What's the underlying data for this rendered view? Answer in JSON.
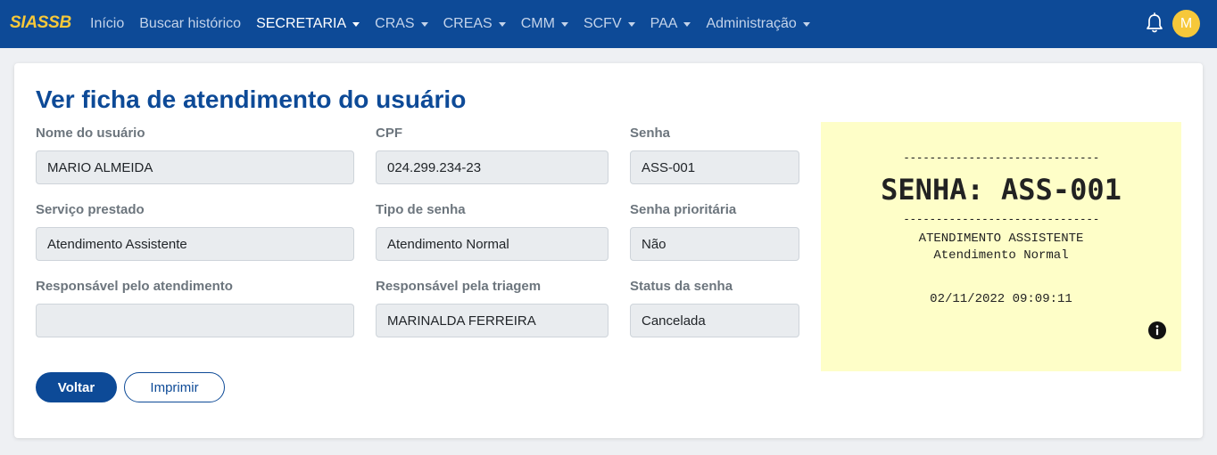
{
  "app": {
    "brand": "SIASSB"
  },
  "nav": {
    "items": [
      {
        "label": "Início",
        "dropdown": false,
        "active": false
      },
      {
        "label": "Buscar histórico",
        "dropdown": false,
        "active": false
      },
      {
        "label": "SECRETARIA",
        "dropdown": true,
        "active": true
      },
      {
        "label": "CRAS",
        "dropdown": true,
        "active": false
      },
      {
        "label": "CREAS",
        "dropdown": true,
        "active": false
      },
      {
        "label": "CMM",
        "dropdown": true,
        "active": false
      },
      {
        "label": "SCFV",
        "dropdown": true,
        "active": false
      },
      {
        "label": "PAA",
        "dropdown": true,
        "active": false
      },
      {
        "label": "Administração",
        "dropdown": true,
        "active": false
      }
    ],
    "bell_icon": "bell-icon",
    "avatar_initial": "M"
  },
  "page": {
    "title": "Ver ficha de atendimento do usuário"
  },
  "form": {
    "nome_usuario": {
      "label": "Nome do usuário",
      "value": "MARIO ALMEIDA"
    },
    "cpf": {
      "label": "CPF",
      "value": "024.299.234-23"
    },
    "senha": {
      "label": "Senha",
      "value": "ASS-001"
    },
    "servico_prestado": {
      "label": "Serviço prestado",
      "value": "Atendimento Assistente"
    },
    "tipo_senha": {
      "label": "Tipo de senha",
      "value": "Atendimento Normal"
    },
    "senha_prioritaria": {
      "label": "Senha prioritária",
      "value": "Não"
    },
    "responsavel_atendimento": {
      "label": "Responsável pelo atendimento",
      "value": ""
    },
    "responsavel_triagem": {
      "label": "Responsável pela triagem",
      "value": "MARINALDA FERREIRA"
    },
    "status_senha": {
      "label": "Status da senha",
      "value": "Cancelada"
    }
  },
  "buttons": {
    "voltar": "Voltar",
    "imprimir": "Imprimir"
  },
  "ticket": {
    "separator": "------------------------------",
    "headline": "SENHA: ASS-001",
    "service": "ATENDIMENTO ASSISTENTE",
    "type": "Atendimento Normal",
    "datetime": "02/11/2022 09:09:11",
    "info_icon": "info-icon"
  },
  "colors": {
    "navbar": "#0d4a97",
    "brand": "#f6c83a",
    "ticket_bg": "#fefec8",
    "page_bg": "#eef0f3"
  }
}
